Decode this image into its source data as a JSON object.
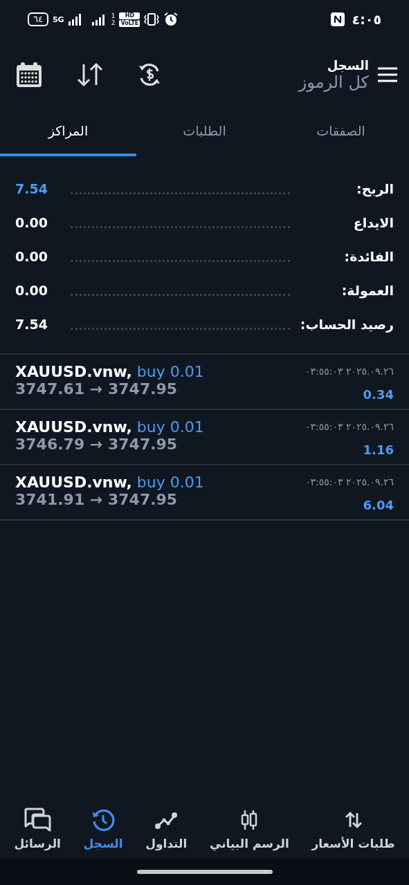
{
  "status_bar": {
    "time": "٤:٠٥",
    "battery": "٦٤",
    "network": "5G",
    "sim_1": "1",
    "sim_2": "2",
    "hd": "HD",
    "volte": "VoLTE"
  },
  "header": {
    "title": "السجل",
    "subtitle": "كل الرموز"
  },
  "tabs": [
    {
      "label": "الصفقات",
      "selected": false
    },
    {
      "label": "الطلبات",
      "selected": false
    },
    {
      "label": "المراكز",
      "selected": true
    }
  ],
  "summary": [
    {
      "label": "الربح:",
      "value": "7.54",
      "kind": "highlight"
    },
    {
      "label": "الايداع",
      "value": "0.00",
      "kind": "plain"
    },
    {
      "label": "الفائدة:",
      "value": "0.00",
      "kind": "plain"
    },
    {
      "label": "العمولة:",
      "value": "0.00",
      "kind": "plain"
    },
    {
      "label": "رصيد الحساب:",
      "value": "7.54",
      "kind": "plain"
    }
  ],
  "positions": [
    {
      "symbol": "XAUUSD.vnw,",
      "side": "buy 0.01",
      "prices": "3747.61 → 3747.95",
      "time": "٢٠٢٥.٠٩.٢٦ ٠٣:٥٥:٠٣",
      "profit": "0.34"
    },
    {
      "symbol": "XAUUSD.vnw,",
      "side": "buy 0.01",
      "prices": "3746.79 → 3747.95",
      "time": "٢٠٢٥.٠٩.٢٦ ٠٣:٥٥:٠٣",
      "profit": "1.16"
    },
    {
      "symbol": "XAUUSD.vnw,",
      "side": "buy 0.01",
      "prices": "3741.91 → 3747.95",
      "time": "٢٠٢٥.٠٩.٢٦ ٠٣:٥٥:٠٣",
      "profit": "6.04"
    }
  ],
  "nav": [
    {
      "label": "طلبات الأسعار",
      "kind": "quotes",
      "selected": false
    },
    {
      "label": "الرسم البياني",
      "kind": "chart",
      "selected": false
    },
    {
      "label": "التداول",
      "kind": "trade",
      "selected": false
    },
    {
      "label": "السجل",
      "kind": "history",
      "selected": true
    },
    {
      "label": "الرسائل",
      "kind": "messages",
      "selected": false
    }
  ]
}
